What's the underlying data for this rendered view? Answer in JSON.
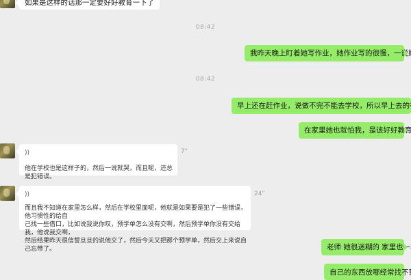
{
  "messages": {
    "m1_text": "如果是这样的话那一定要好好教育一下了",
    "t1": "08:42",
    "m2_text": "我昨天晚上盯着她写作业，她作业写的很慢，一说她就哭",
    "t2": "08:42",
    "m3_text": "早上还在赶作业，说做不完不能去学校，所以早上去的有点晚",
    "m4_text": "在家里她也就怕我，是该好好教育了",
    "v1_icon": "))",
    "v1_duration": "7\"",
    "v1_transcript": "他在学校也是这样子的，然后一说就哭，而且呢，还总是犯错误。",
    "v2_icon": "))",
    "v2_duration": "24\"",
    "v2_line1": "而且我不知道在家里怎么样，然后在学校里面呢，他就是如果要是犯了一些错误，他习惯性的给自",
    "v2_line2": "己找一些借口，比如说我说你叹，预学单怎么没有交啊，然后预学单你没有交给我，他说我交啊，",
    "v2_line3": "然后结果昨天很信誓旦旦的说他交了，然后今天又把那个预学单，然后交上来说自己忘带了。",
    "m5_text": "老师 她很迷糊的 家里也一样",
    "m6_text": "自己的东西放哪经常找不到"
  },
  "icons": {
    "voice": "voice-wave-icon"
  },
  "colors": {
    "background": "#ededed",
    "outgoing": "#95ec69",
    "incoming": "#ffffff",
    "timestamp": "#a8a8a8"
  }
}
